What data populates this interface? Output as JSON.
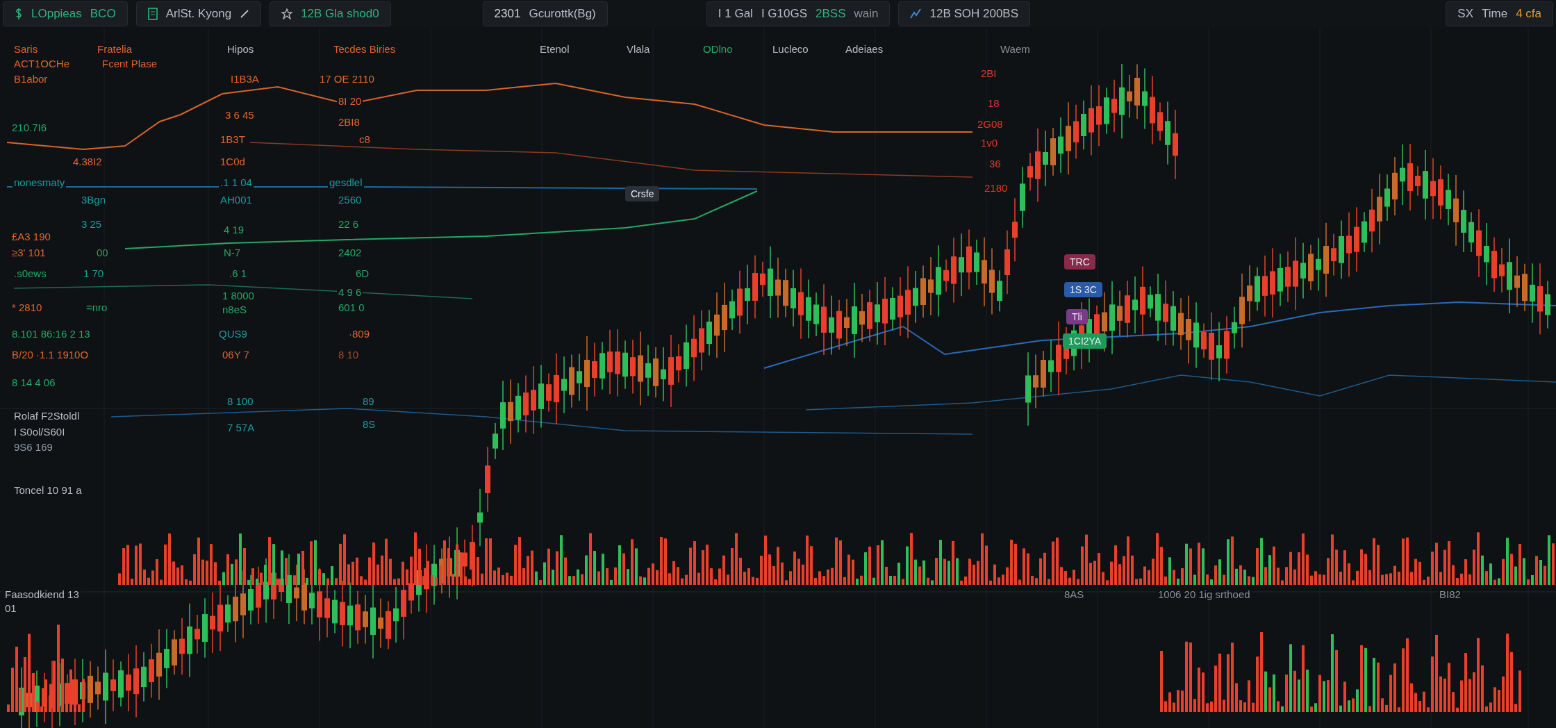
{
  "toolbar": [
    {
      "items": [
        {
          "text": "LOppieas",
          "color": "#2fb37a"
        },
        {
          "text": "BCO",
          "color": "#2fb37a"
        }
      ]
    },
    {
      "items": [
        {
          "text": "ArlSt. Kyong",
          "color": "#b8bcc2"
        }
      ]
    },
    {
      "items": [
        {
          "text": "12B Gla shod0",
          "color": "#2fb37a"
        }
      ]
    },
    {
      "items": [
        {
          "text": "2301",
          "color": "#d0d3d8"
        },
        {
          "text": "Gcurottk(Bg)",
          "color": "#b8bcc2"
        }
      ]
    },
    {
      "items": [
        {
          "text": "I 1 Gal",
          "color": "#b8bcc2"
        },
        {
          "text": "I G10GS",
          "color": "#b8bcc2"
        },
        {
          "text": "2BSS",
          "color": "#2fb37a"
        },
        {
          "text": "wain",
          "color": "#8a8e94"
        }
      ]
    },
    {
      "items": [
        {
          "text": "12B SOH 200BS",
          "color": "#b8bcc2"
        }
      ]
    },
    {
      "items": [
        {
          "text": "SX",
          "color": "#b8bcc2"
        },
        {
          "text": "Time",
          "color": "#b8bcc2"
        },
        {
          "text": "4 cfa",
          "color": "#e8962c"
        }
      ]
    }
  ],
  "labels": [
    {
      "text": "Saris",
      "color": "#e0642c"
    },
    {
      "text": "Fratelia",
      "color": "#e0642c"
    },
    {
      "text": "Hipos",
      "color": "#b8bcc2"
    },
    {
      "text": "Tecdes Biries",
      "color": "#e0642c"
    },
    {
      "text": "Etenol",
      "color": "#b8bcc2"
    },
    {
      "text": "Vlala",
      "color": "#b8bcc2"
    },
    {
      "text": "ODlno",
      "color": "#25a865"
    },
    {
      "text": "Lucleco",
      "color": "#b8bcc2"
    },
    {
      "text": "Adeiaes",
      "color": "#b8bcc2"
    },
    {
      "text": "Waem",
      "color": "#8a8e94"
    },
    {
      "text": "ACT1OCHe",
      "color": "#e0642c"
    },
    {
      "text": "Fcent Plase",
      "color": "#e0642c"
    },
    {
      "text": "B1abor",
      "color": "#e0642c"
    },
    {
      "text": "I1B3A",
      "color": "#e0642c"
    },
    {
      "text": "17 OE 2110",
      "color": "#e0642c"
    },
    {
      "text": "210.7I6",
      "color": "#25a865"
    },
    {
      "text": "3 6 45",
      "color": "#e0642c"
    },
    {
      "text": "8I 20",
      "color": "#e0642c"
    },
    {
      "text": "2BI8",
      "color": "#e0642c"
    },
    {
      "text": "1B3T",
      "color": "#e0642c"
    },
    {
      "text": "c8",
      "color": "#e0642c"
    },
    {
      "text": "4.38I2",
      "color": "#e0642c"
    },
    {
      "text": "1C0d",
      "color": "#e0642c"
    },
    {
      "text": "nonesmaty",
      "color": "#1e9aa0"
    },
    {
      "text": ".1 1 04",
      "color": "#1e9aa0"
    },
    {
      "text": "gesdlel",
      "color": "#1e9aa0"
    },
    {
      "text": "3Bgn",
      "color": "#1e9aa0"
    },
    {
      "text": "AH001",
      "color": "#1e9aa0"
    },
    {
      "text": "2560",
      "color": "#1e9aa0"
    },
    {
      "text": "3 25",
      "color": "#1e9aa0"
    },
    {
      "text": "4 19",
      "color": "#25a865"
    },
    {
      "text": "22 6",
      "color": "#25a865"
    },
    {
      "text": "£A3 190",
      "color": "#e0642c"
    },
    {
      "text": "≥3' 101",
      "color": "#e0642c"
    },
    {
      "text": "00",
      "color": "#25a865"
    },
    {
      "text": "N-7",
      "color": "#25a865"
    },
    {
      "text": "2402",
      "color": "#25a865"
    },
    {
      "text": ".s0ews",
      "color": "#25a865"
    },
    {
      "text": "1 70",
      "color": "#1e9aa0"
    },
    {
      "text": ".6 1",
      "color": "#25a865"
    },
    {
      "text": "6D",
      "color": "#25a865"
    },
    {
      "text": "1 8000",
      "color": "#25a865"
    },
    {
      "text": "4 9 6",
      "color": "#25a865"
    },
    {
      "text": "* 2810",
      "color": "#e0642c"
    },
    {
      "text": "=nro",
      "color": "#25a865"
    },
    {
      "text": "n8eS",
      "color": "#25a865"
    },
    {
      "text": "601 0",
      "color": "#25a865"
    },
    {
      "text": "8.101 86:16 2 13",
      "color": "#25a865"
    },
    {
      "text": "QUS9",
      "color": "#1e9aa0"
    },
    {
      "text": "·809",
      "color": "#e0642c"
    },
    {
      "text": "B/20 ·1.1 1910O",
      "color": "#e0642c"
    },
    {
      "text": "06Y 7",
      "color": "#e0642c"
    },
    {
      "text": "8 10",
      "color": "#a04a2c"
    },
    {
      "text": "8 14 4 06",
      "color": "#25a865"
    },
    {
      "text": "8 100",
      "color": "#1e9aa0"
    },
    {
      "text": "89",
      "color": "#1e9aa0"
    },
    {
      "text": "Rolaf F2Stoldl",
      "color": "#b8bcc2"
    },
    {
      "text": "7 57A",
      "color": "#1e9aa0"
    },
    {
      "text": "8S",
      "color": "#1e9aa0"
    },
    {
      "text": "I S0ol/S60I",
      "color": "#b8bcc2"
    },
    {
      "text": "9S6 169",
      "color": "#8a9aa6"
    },
    {
      "text": "Toncel 10 91 a",
      "color": "#b8bcc2"
    },
    {
      "text": "2BI",
      "color": "#e03a2a"
    },
    {
      "text": "18",
      "color": "#e03a2a"
    },
    {
      "text": "2G08",
      "color": "#e03a2a"
    },
    {
      "text": "1v0",
      "color": "#e03a2a"
    },
    {
      "text": "36",
      "color": "#e03a2a"
    },
    {
      "text": "2180",
      "color": "#e03a2a"
    },
    {
      "text": "Faasodkiend 13",
      "color": "#b8bcc2"
    },
    {
      "text": "01",
      "color": "#b8bcc2"
    },
    {
      "text": "8AS",
      "color": "#8a8e94"
    },
    {
      "text": "1006 20 1ig srthoed",
      "color": "#8a8e94"
    },
    {
      "text": "BI82",
      "color": "#8a8e94"
    }
  ],
  "tags": [
    {
      "text": "Crsfe",
      "color": "#2a3038"
    },
    {
      "text": "TRC",
      "color": "#8a2a4a"
    },
    {
      "text": "1S 3C",
      "color": "#2a5aa8"
    },
    {
      "text": "Tli",
      "color": "#7a3a8a"
    },
    {
      "text": "1CI2YA",
      "color": "#1f9a5a"
    }
  ]
}
